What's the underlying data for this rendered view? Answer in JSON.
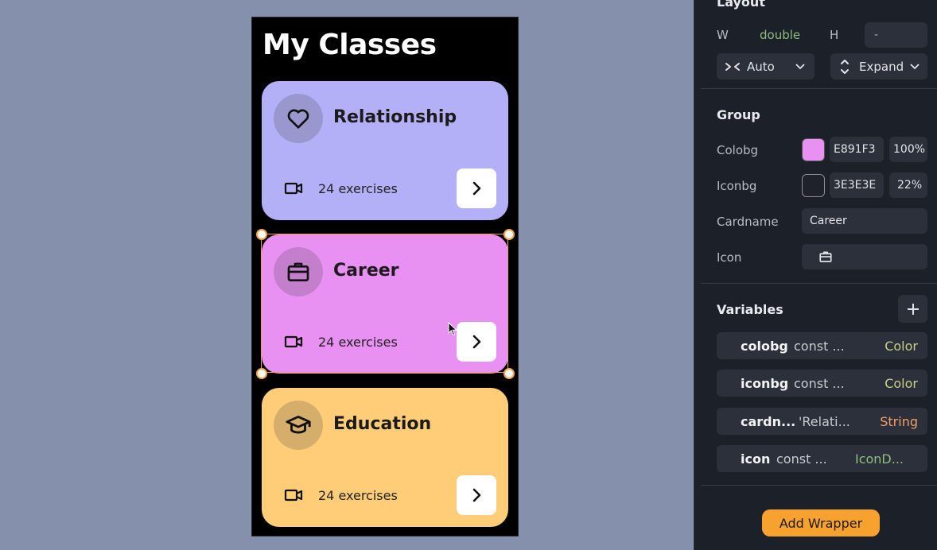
{
  "phone": {
    "title": "My Classes",
    "cards": [
      {
        "name": "Relationship",
        "exercises": "24 exercises",
        "icon": "heart-icon",
        "bg": "#B3B0F7",
        "iconbg": "#3E3E3E"
      },
      {
        "name": "Career",
        "exercises": "24 exercises",
        "icon": "briefcase-icon",
        "bg": "#E891F3",
        "iconbg": "#3E3E3E"
      },
      {
        "name": "Education",
        "exercises": "24 exercises",
        "icon": "graduation-cap-icon",
        "bg": "#FFCD78",
        "iconbg": "#3E3E3E"
      }
    ]
  },
  "panel": {
    "layout": {
      "heading": "Layout",
      "w_label": "W",
      "w_value": "double",
      "h_label": "H",
      "h_value": "-",
      "width_mode": "Auto",
      "height_mode": "Expand"
    },
    "group": {
      "heading": "Group",
      "colobg_label": "Colobg",
      "colobg_hex": "E891F3",
      "colobg_opacity": "100%",
      "colobg_color": "#E891F3",
      "iconbg_label": "Iconbg",
      "iconbg_hex": "3E3E3E",
      "iconbg_opacity": "22%",
      "cardname_label": "Cardname",
      "cardname_value": "Career",
      "icon_label": "Icon",
      "icon_value": "briefcase-icon"
    },
    "variables": {
      "heading": "Variables",
      "items": [
        {
          "name": "colobg",
          "value": "const ...",
          "type": "Color",
          "type_color": "#c9cf86"
        },
        {
          "name": "iconbg",
          "value": "const ...",
          "type": "Color",
          "type_color": "#c9cf86"
        },
        {
          "name": "cardn...",
          "value": "'Relati...",
          "type": "String",
          "type_color": "#f0a06a"
        },
        {
          "name": "icon",
          "value": "const ...",
          "type": "IconD...",
          "type_color": "#8fbf7f"
        }
      ]
    },
    "add_wrapper_label": "Add Wrapper"
  },
  "colors": {
    "canvas_bg": "#8590ad",
    "selection": "#f3a545",
    "panel_bg": "#1c2029",
    "accent_button": "#f7a12f"
  }
}
